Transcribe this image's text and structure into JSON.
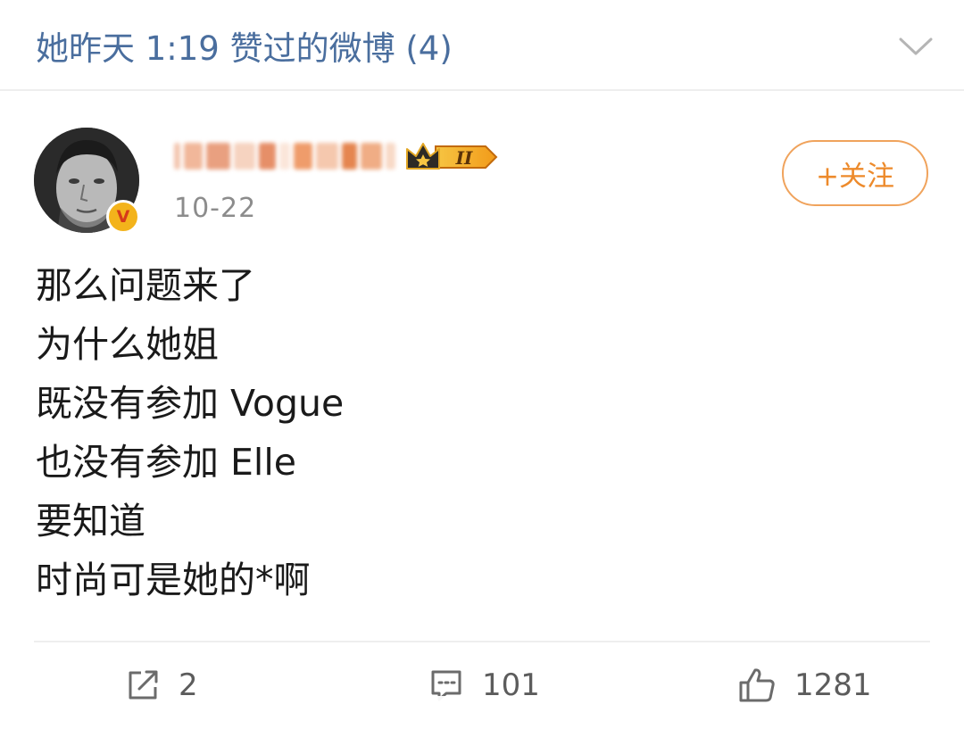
{
  "header": {
    "title": "她昨天 1:19 赞过的微博 (4)",
    "chevron_icon": "chevron-down-icon"
  },
  "post": {
    "avatar_icon": "avatar",
    "verified_icon": "verified-v-icon",
    "verified_letter": "V",
    "level_badge_icon": "crown-level-icon",
    "level_badge_text": "II",
    "date": "10-22",
    "follow_label": "+关注",
    "lines": [
      "那么问题来了",
      "为什么她姐",
      "既没有参加 Vogue",
      "也没有参加 Elle",
      "要知道",
      "时尚可是她的*啊"
    ]
  },
  "actions": {
    "repost": {
      "icon": "share-icon",
      "count": "2"
    },
    "comment": {
      "icon": "comment-icon",
      "count": "101"
    },
    "like": {
      "icon": "thumbs-up-icon",
      "count": "1281"
    }
  },
  "colors": {
    "header_text": "#4a6e9e",
    "follow_accent": "#ed8a2b",
    "date_text": "#8c8c8c",
    "body_text": "#1a1a1a",
    "action_text": "#5c5c5c"
  }
}
